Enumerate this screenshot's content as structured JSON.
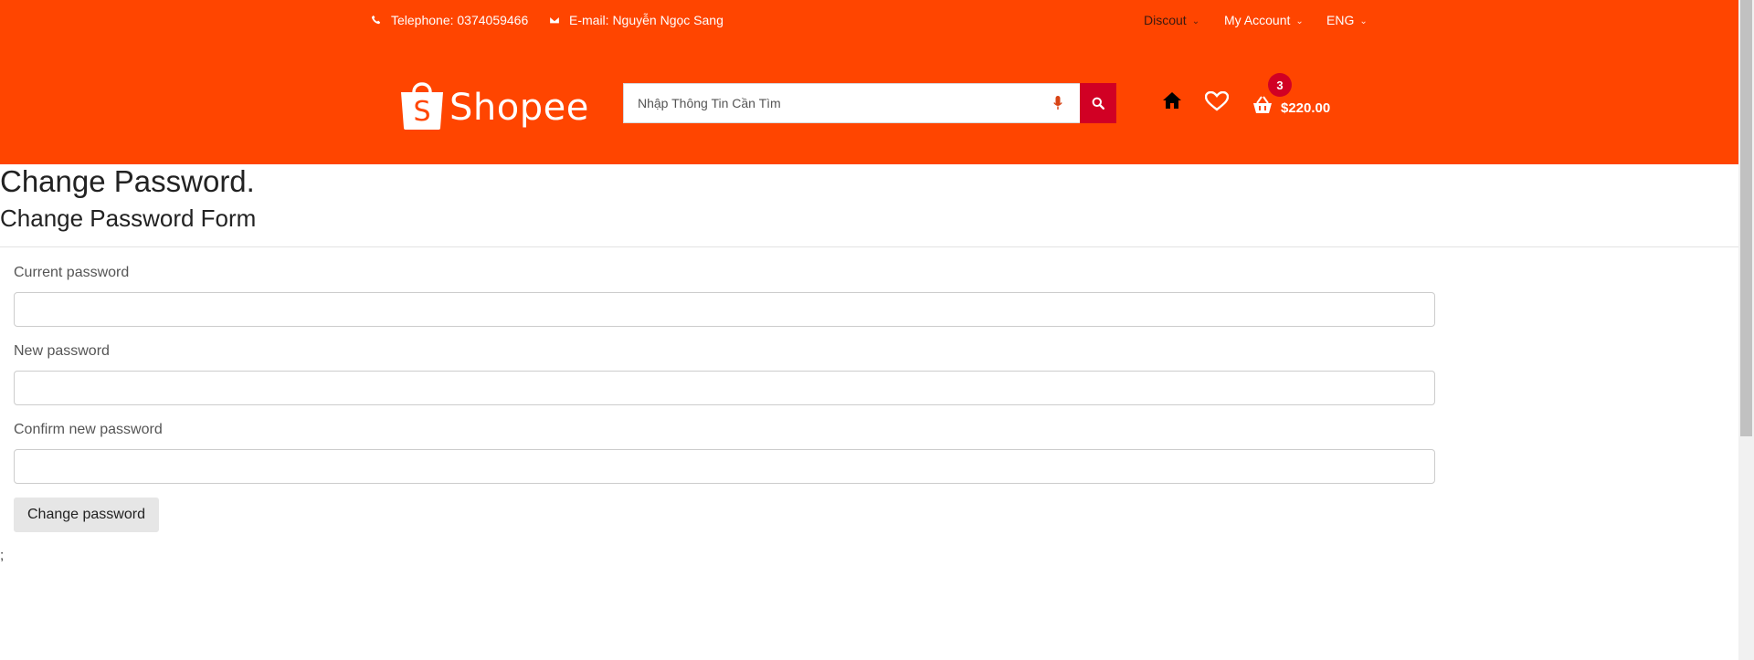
{
  "topbar": {
    "telephone": "Telephone: 0374059466",
    "email": "E-mail: Nguyễn Ngọc Sang",
    "discount_label": "Discout",
    "account_label": "My Account",
    "language_label": "ENG"
  },
  "logo": {
    "text": "Shopee",
    "letter": "S"
  },
  "search": {
    "placeholder": "Nhập Thông Tin Cần Tìm"
  },
  "cart": {
    "count": "3",
    "total": "$220.00"
  },
  "page": {
    "title": "Change Password.",
    "form_title": "Change Password Form",
    "fields": {
      "current_label": "Current password",
      "new_label": "New password",
      "confirm_label": "Confirm new password"
    },
    "submit_label": "Change password",
    "trailing_text": ";"
  },
  "colors": {
    "header_bg": "#ff4500",
    "accent": "#d10024"
  },
  "icons": [
    "phone-icon",
    "envelope-icon",
    "chevron-down-icon",
    "microphone-icon",
    "search-icon",
    "home-icon",
    "heart-icon",
    "cart-icon",
    "shopping-bag-logo"
  ]
}
